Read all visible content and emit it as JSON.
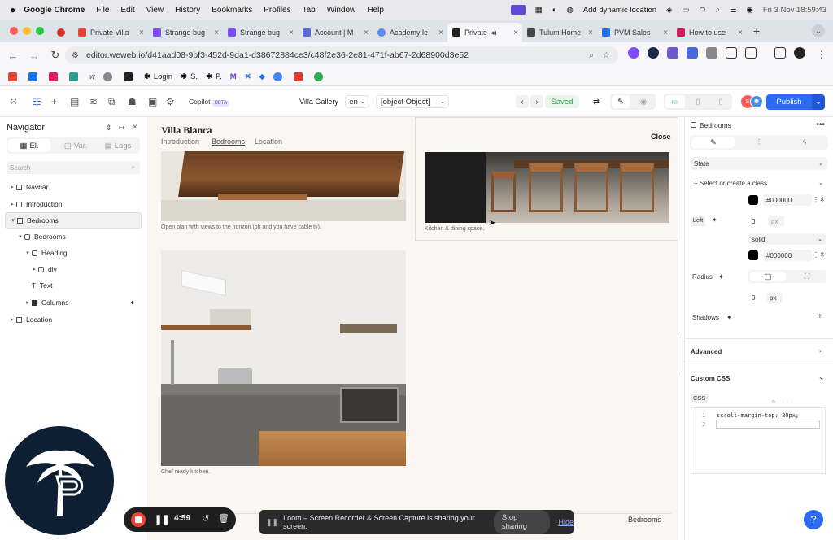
{
  "menubar": {
    "app": "Google Chrome",
    "menus": [
      "File",
      "Edit",
      "View",
      "History",
      "Bookmarks",
      "Profiles",
      "Tab",
      "Window",
      "Help"
    ],
    "status_text": "Add dynamic location",
    "clock": "Fri 3 Nov  18:59:43"
  },
  "tabs": [
    {
      "label": "",
      "color": "#d93025"
    },
    {
      "label": "Private Villa",
      "color": "#ea4335"
    },
    {
      "label": "Strange bug",
      "color": "#7c4dff"
    },
    {
      "label": "Strange bug",
      "color": "#7c4dff"
    },
    {
      "label": "Account | M",
      "color": "#5b6bd5"
    },
    {
      "label": "Academy le",
      "color": "#5b8def"
    },
    {
      "label": "Private",
      "color": "#222222",
      "active": true
    },
    {
      "label": "Tulum Home",
      "color": "#444444"
    },
    {
      "label": "PVM Sales",
      "color": "#1a73e8"
    },
    {
      "label": "How to use",
      "color": "#d81b60"
    }
  ],
  "url": "editor.weweb.io/d41aad08-9bf3-452d-9da1-d38672884ce3/c48f2e36-2e81-471f-ab67-2d68900d3e52",
  "bookmarks": [
    "Login",
    "S.",
    "P."
  ],
  "toolbar": {
    "copilot": "Copilot",
    "beta": "BETA",
    "page_name": "Villa Gallery",
    "lang": "en",
    "object": "[object Object]",
    "saved": "Saved",
    "publish": "Publish",
    "avatar_initial": "S"
  },
  "navigator": {
    "title": "Navigator",
    "tabs": [
      "El.",
      "Var.",
      "Logs"
    ],
    "search_placeholder": "Search",
    "tree": [
      {
        "label": "Navbar",
        "depth": 0,
        "caret": "▸"
      },
      {
        "label": "Introduction",
        "depth": 0,
        "caret": "▸"
      },
      {
        "label": "Bedrooms",
        "depth": 0,
        "caret": "▾",
        "selected": true
      },
      {
        "label": "Bedrooms",
        "depth": 1,
        "caret": "▾"
      },
      {
        "label": "Heading",
        "depth": 2,
        "caret": "▾"
      },
      {
        "label": "div",
        "depth": 3,
        "caret": "▸"
      },
      {
        "label": "Text",
        "depth": 2,
        "caret": ""
      },
      {
        "label": "Columns",
        "depth": 2,
        "caret": "▸"
      },
      {
        "label": "Location",
        "depth": 0,
        "caret": "▸"
      }
    ]
  },
  "canvas": {
    "site_title": "Villa Blanca",
    "nav": [
      "Introduction",
      "Bedrooms",
      "Location"
    ],
    "close": "Close",
    "captions": {
      "living": "Open plan with views to the horizon (oh and you have cable tv).",
      "dining": "Kitchen & dining space.",
      "kitchen": "Chef ready kitchen."
    },
    "footer_label": "Bedrooms"
  },
  "panel": {
    "title": "Bedrooms",
    "state": "State",
    "class_select": "+ Select or create a class",
    "color1": "#000000",
    "left_label": "Left",
    "width_value": "0",
    "unit": "px",
    "style": "solid",
    "color2": "#000000",
    "radius_label": "Radius",
    "radius_value": "0",
    "shadows": "Shadows",
    "advanced": "Advanced",
    "custom_css": "Custom CSS",
    "css_tab": "CSS",
    "css_lines": [
      "scroll-margin-top: 20px;",
      ""
    ]
  },
  "recorder": {
    "time": "4:59"
  },
  "loom": {
    "message": "Loom – Screen Recorder & Screen Capture is sharing your screen.",
    "stop": "Stop sharing",
    "hide": "Hide"
  }
}
